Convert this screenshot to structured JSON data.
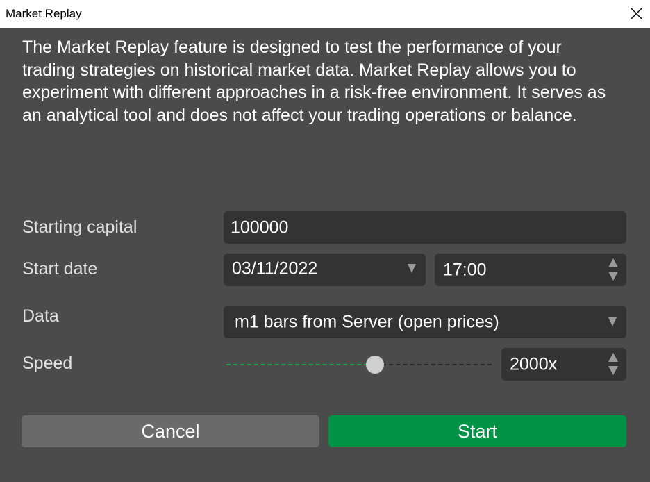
{
  "window": {
    "title": "Market Replay"
  },
  "description": "The Market Replay feature is designed to test the performance of your trading strategies on historical market data. Market Replay allows you to experiment with different approaches in a risk-free environment. It serves as an analytical tool and does not affect your trading operations or balance.",
  "form": {
    "starting_capital": {
      "label": "Starting capital",
      "value": "100000"
    },
    "start_date": {
      "label": "Start date",
      "date": "03/11/2022",
      "time": "17:00"
    },
    "data": {
      "label": "Data",
      "value": "m1 bars from Server (open prices)"
    },
    "speed": {
      "label": "Speed",
      "value": "2000x",
      "slider_fraction": 0.56
    }
  },
  "buttons": {
    "cancel": "Cancel",
    "start": "Start"
  },
  "colors": {
    "background": "#4b4b4b",
    "field": "#333333",
    "accent": "#009245",
    "cancel": "#6a6a6a"
  },
  "icons": {
    "close": "close-icon",
    "dropdown": "chevron-down-icon",
    "spin_up": "spin-up-icon",
    "spin_down": "spin-down-icon"
  }
}
